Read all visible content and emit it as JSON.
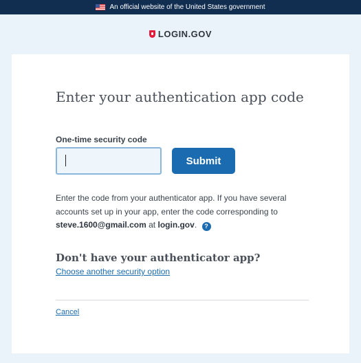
{
  "gov_banner": {
    "text": "An official website of the United States government",
    "flag_icon": "us-flag-icon"
  },
  "brand": {
    "name": "LOGIN.GOV",
    "icon": "shield-icon"
  },
  "form": {
    "title": "Enter your authentication app code",
    "field_label": "One-time security code",
    "input_value": "",
    "submit_label": "Submit"
  },
  "description": {
    "text_before": "Enter the code from your authenticator app. If you have several accounts set up in your app, enter the code corresponding to",
    "email": "steve.1600@gmail.com",
    "at": "at",
    "domain": "login.gov",
    "period": ".",
    "help_icon": "?"
  },
  "alternate": {
    "heading": "Don't have your authenticator app?",
    "link": "Choose another security option"
  },
  "cancel_label": "Cancel",
  "colors": {
    "banner": "#112e51",
    "primary": "#1b6bb0",
    "accent_red": "#e21c3d",
    "page_bg": "#eaf2fa"
  }
}
